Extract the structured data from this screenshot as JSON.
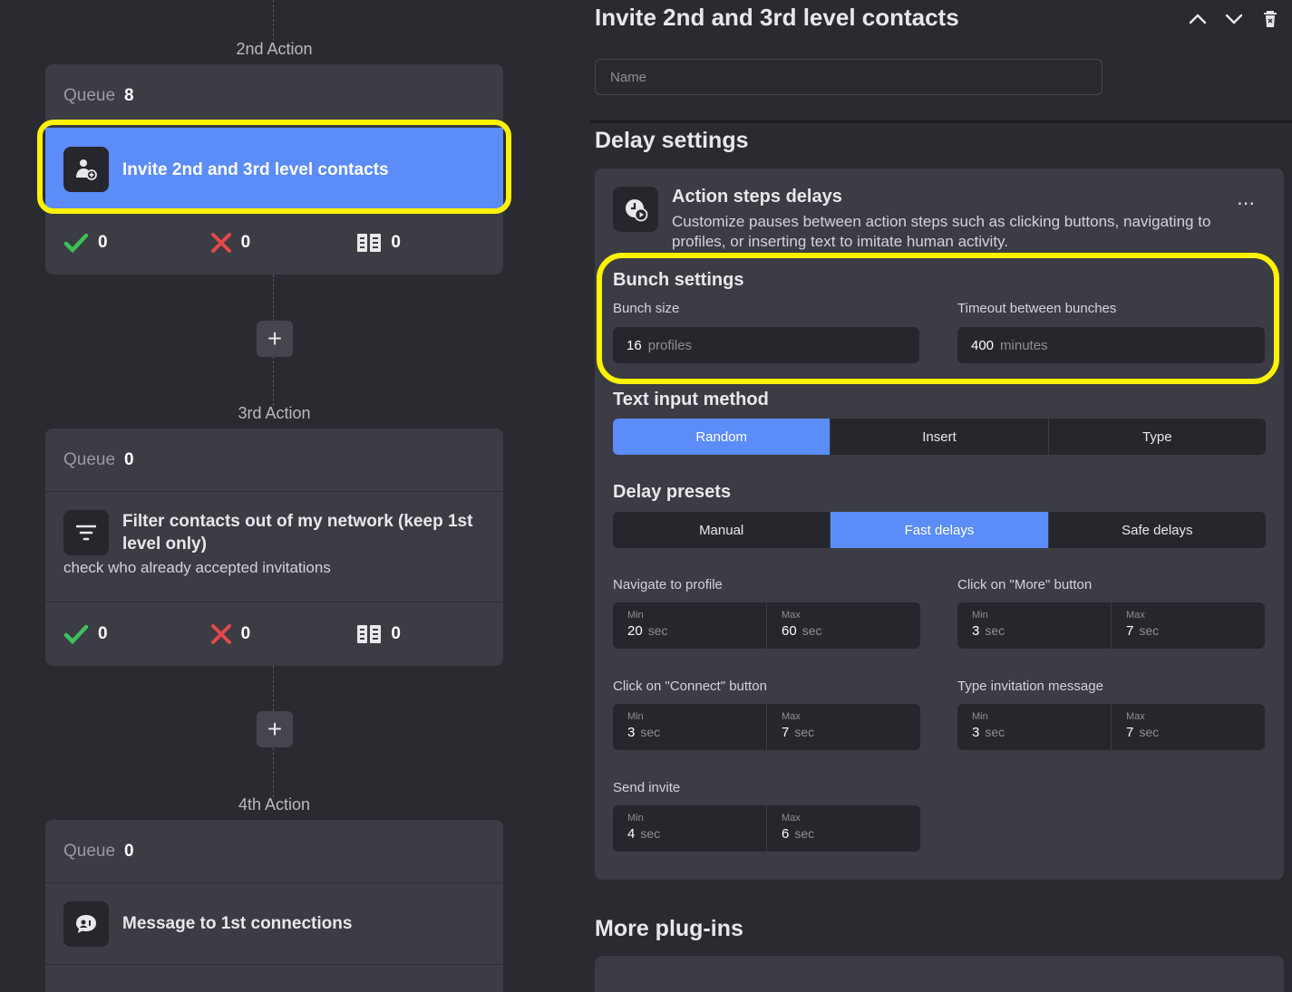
{
  "colors": {
    "accent": "#5b8cf7",
    "highlight": "#fff200",
    "success": "#3fbf5a",
    "danger": "#e54848"
  },
  "left": {
    "actions": [
      {
        "label": "2nd Action",
        "queue_label": "Queue",
        "queue_count": "8",
        "step_title": "Invite 2nd and 3rd level contacts",
        "icon": "user-add-icon",
        "stats": {
          "success": "0",
          "failed": "0",
          "skipped": "0"
        }
      },
      {
        "label": "3rd Action",
        "queue_label": "Queue",
        "queue_count": "0",
        "step_title": "Filter contacts out of my network (keep 1st level only)",
        "step_subtitle": "check who already accepted invitations",
        "icon": "filter-icon",
        "stats": {
          "success": "0",
          "failed": "0",
          "skipped": "0"
        }
      },
      {
        "label": "4th Action",
        "queue_label": "Queue",
        "queue_count": "0",
        "step_title": "Message to 1st connections",
        "icon": "message-icon"
      }
    ]
  },
  "panel": {
    "title": "Invite 2nd and 3rd level contacts",
    "name_placeholder": "Name",
    "delay_settings_title": "Delay settings",
    "action_steps": {
      "title": "Action steps delays",
      "description": "Customize pauses between action steps such as clicking buttons, navigating to profiles, or inserting text to imitate human activity."
    },
    "bunch": {
      "title": "Bunch settings",
      "size_label": "Bunch size",
      "size_value": "16",
      "size_unit": "profiles",
      "timeout_label": "Timeout between bunches",
      "timeout_value": "400",
      "timeout_unit": "minutes"
    },
    "text_input": {
      "title": "Text input method",
      "options": [
        "Random",
        "Insert",
        "Type"
      ],
      "selected": "Random"
    },
    "presets": {
      "title": "Delay presets",
      "options": [
        "Manual",
        "Fast delays",
        "Safe delays"
      ],
      "selected": "Fast delays"
    },
    "delays": [
      {
        "label": "Navigate to profile",
        "min_label": "Min",
        "min": "20",
        "max_label": "Max",
        "max": "60",
        "unit": "sec"
      },
      {
        "label": "Click on \"More\" button",
        "min_label": "Min",
        "min": "3",
        "max_label": "Max",
        "max": "7",
        "unit": "sec"
      },
      {
        "label": "Click on \"Connect\" button",
        "min_label": "Min",
        "min": "3",
        "max_label": "Max",
        "max": "7",
        "unit": "sec"
      },
      {
        "label": "Type invitation message",
        "min_label": "Min",
        "min": "3",
        "max_label": "Max",
        "max": "7",
        "unit": "sec"
      },
      {
        "label": "Send invite",
        "min_label": "Min",
        "min": "4",
        "max_label": "Max",
        "max": "6",
        "unit": "sec"
      }
    ],
    "more_plugins_title": "More plug-ins"
  }
}
